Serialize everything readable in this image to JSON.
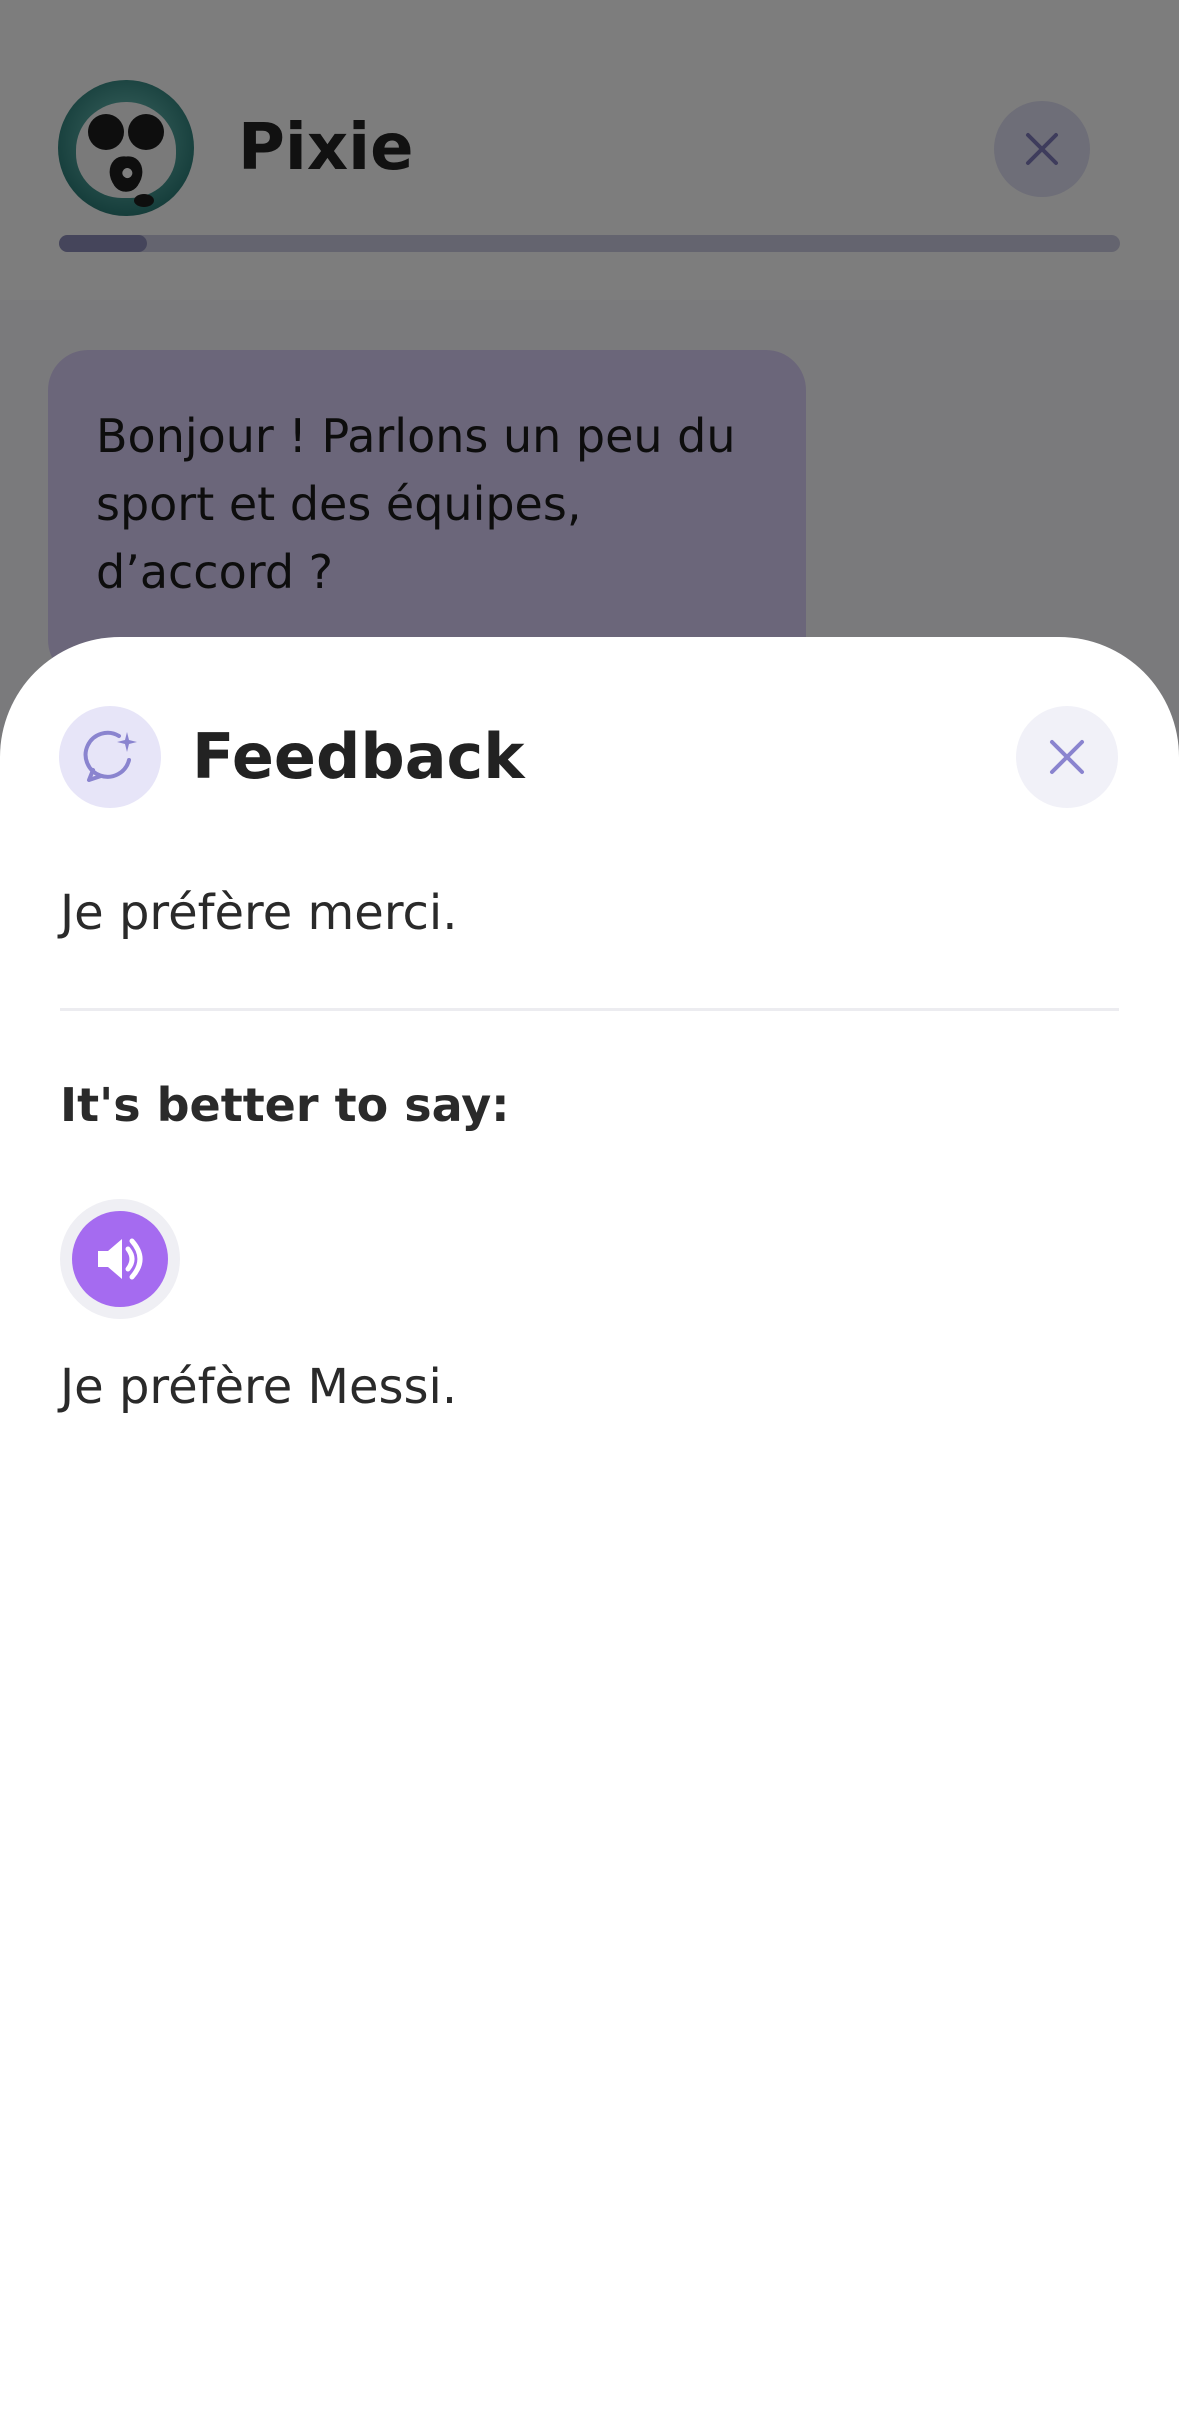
{
  "header": {
    "title": "Pixie",
    "avatar_icon": "panda-avatar",
    "close_icon": "close-icon",
    "progress_fraction": 0.083
  },
  "chat": {
    "bot_message": "Bonjour ! Parlons un peu du sport et des équipes, d’accord ?"
  },
  "feedback": {
    "title": "Feedback",
    "icon": "chat-sparkle-icon",
    "close_icon": "close-icon",
    "user_sentence": "Je préfère merci.",
    "better_label": "It's better to say:",
    "audio_icon": "speaker-icon",
    "corrected_sentence": "Je préfère Messi."
  },
  "colors": {
    "accent": "#a56bf0",
    "bubble": "#d7cdf5",
    "icon_stroke": "#8a84cf"
  }
}
